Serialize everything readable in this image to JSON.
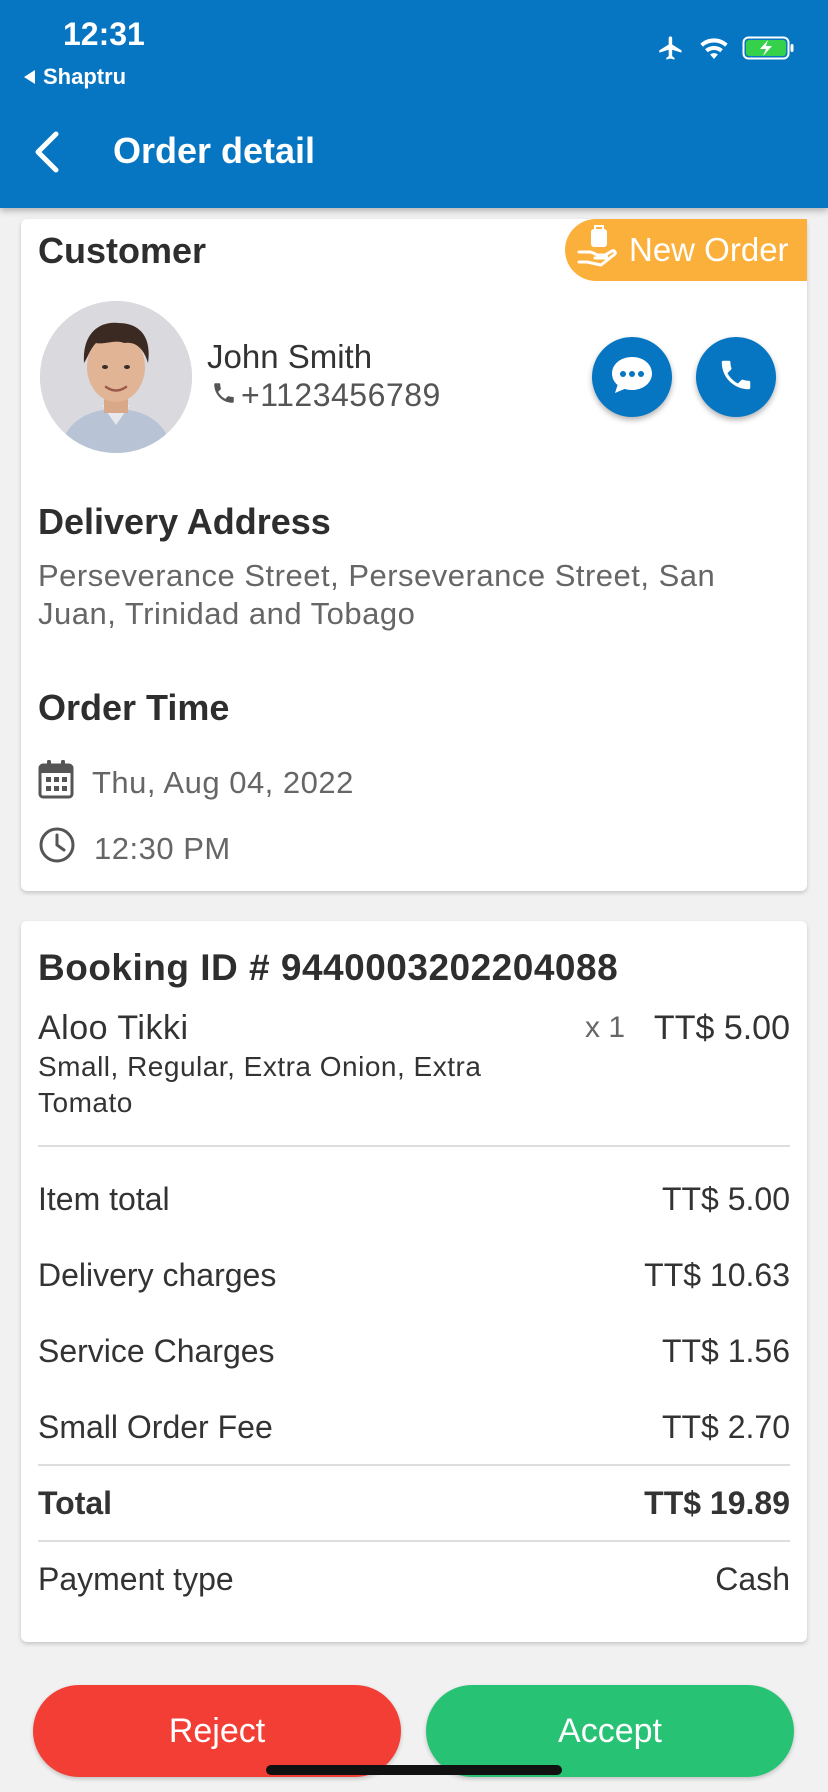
{
  "status_bar": {
    "time": "12:31",
    "back_app": "Shaptru",
    "icons": [
      "airplane-icon",
      "wifi-icon",
      "battery-charging-icon"
    ]
  },
  "header": {
    "title": "Order detail",
    "back_icon": "chevron-left-icon"
  },
  "customer": {
    "section_title": "Customer",
    "badge": "New Order",
    "name": "John Smith",
    "phone": "+1123456789",
    "chat_icon": "chat-bubble-icon",
    "call_icon": "phone-icon"
  },
  "delivery": {
    "title": "Delivery Address",
    "address": "Perseverance Street, Perseverance Street, San Juan, Trinidad and Tobago"
  },
  "order_time": {
    "title": "Order Time",
    "date": "Thu, Aug 04, 2022",
    "time": "12:30 PM"
  },
  "booking": {
    "id": "Booking ID # 9440003202204088",
    "items": [
      {
        "name": "Aloo Tikki",
        "qty": "x 1",
        "price": "TT$ 5.00",
        "options": "Small, Regular, Extra Onion, Extra Tomato"
      }
    ]
  },
  "summary": {
    "item_total_label": "Item total",
    "item_total": "TT$ 5.00",
    "delivery_label": "Delivery charges",
    "delivery": "TT$ 10.63",
    "service_label": "Service Charges",
    "service": "TT$ 1.56",
    "small_order_label": "Small Order Fee",
    "small_order": "TT$ 2.70",
    "total_label": "Total",
    "total": "TT$ 19.89",
    "payment_label": "Payment type",
    "payment": "Cash"
  },
  "actions": {
    "reject": "Reject",
    "accept": "Accept"
  },
  "colors": {
    "primary": "#0676c2",
    "badge": "#fbb03b",
    "reject": "#f23e35",
    "accept": "#28c274"
  }
}
